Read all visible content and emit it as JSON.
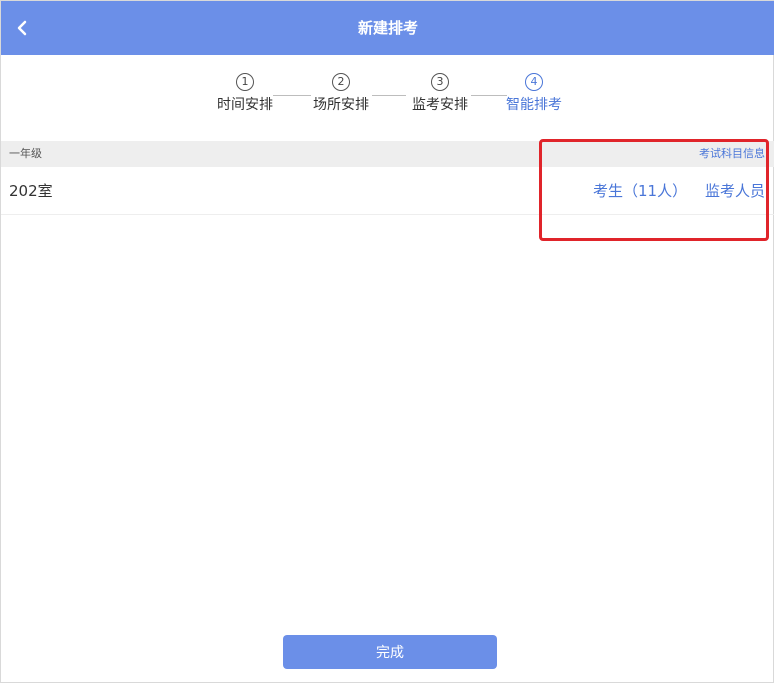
{
  "header": {
    "title": "新建排考",
    "back_icon": "chevron-left-icon",
    "color": "#6b8fe8"
  },
  "steps": [
    {
      "num": "1",
      "label": "时间安排",
      "active": false
    },
    {
      "num": "2",
      "label": "场所安排",
      "active": false
    },
    {
      "num": "3",
      "label": "监考安排",
      "active": false
    },
    {
      "num": "4",
      "label": "智能排考",
      "active": true
    }
  ],
  "group": {
    "title": "一年级",
    "exam_info_link": "考试科目信息"
  },
  "room": {
    "name": "202室",
    "students_link": "考生（11人）",
    "proctors_link": "监考人员"
  },
  "footer": {
    "done_label": "完成"
  },
  "colors": {
    "accent": "#4a76d8",
    "highlight": "#e0242a"
  }
}
